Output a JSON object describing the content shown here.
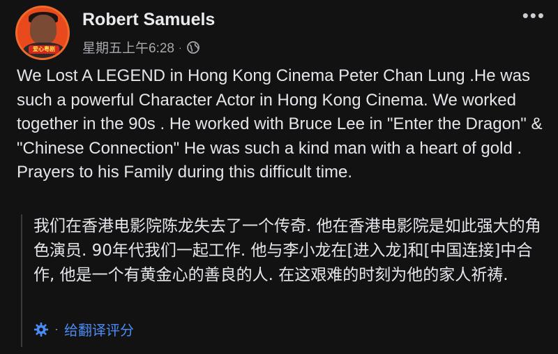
{
  "post": {
    "author": "Robert Samuels",
    "timestamp": "星期五上午6:28",
    "separator": "·",
    "privacy_icon": "globe-icon",
    "more_label": "•••",
    "avatar_badge": "爱心粤剧",
    "text": "We Lost A LEGEND in Hong Kong Cinema Peter Chan Lung .He was such a powerful Character Actor in Hong Kong Cinema. We worked together in the 90s . He worked with Bruce Lee in \"Enter the Dragon\" & \"Chinese Connection\" He was such a kind man with a heart of gold . Prayers to his Family during this difficult time.",
    "translation": "我们在香港电影院陈龙失去了一个传奇. 他在香港电影院是如此强大的角色演员. 90年代我们一起工作. 他与李小龙在[进入龙]和[中国连接]中合作, 他是一个有黄金心的善良的人. 在这艰难的时刻为他的家人祈祷.",
    "rate_separator": "·",
    "rate_translation_label": "给翻译评分"
  },
  "colors": {
    "background": "#121212",
    "text": "#e4e6eb",
    "secondary_text": "#a6a9ae",
    "link": "#4c8bf5",
    "avatar_ring": "#e8491d"
  }
}
